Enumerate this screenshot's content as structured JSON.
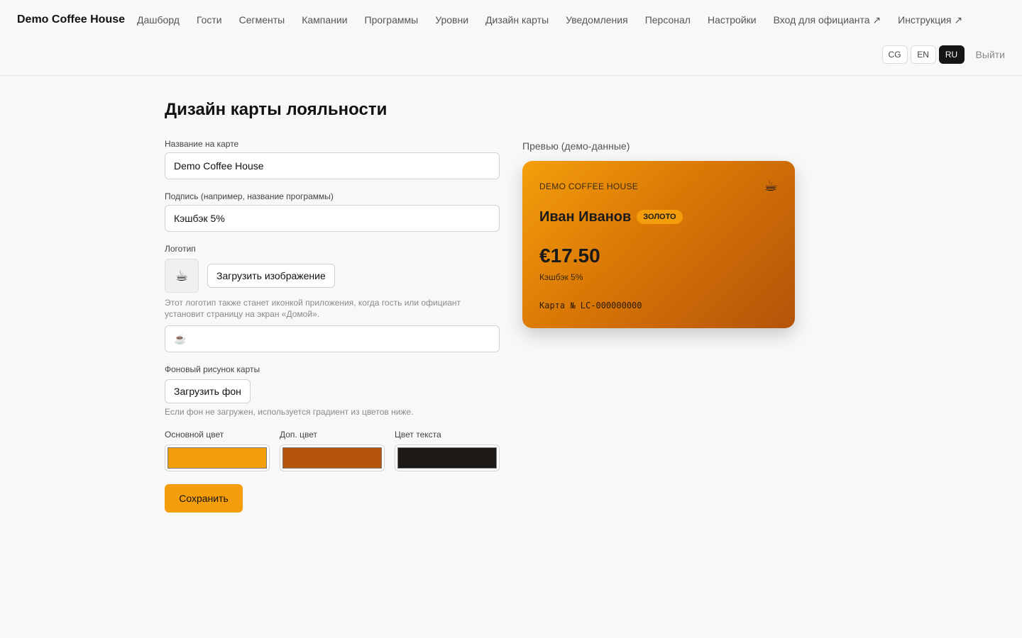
{
  "header": {
    "brand": "Demo Coffee House",
    "nav": [
      "Дашборд",
      "Гости",
      "Сегменты",
      "Кампании",
      "Программы",
      "Уровни",
      "Дизайн карты",
      "Уведомления",
      "Персонал",
      "Настройки",
      "Вход для официанта ↗",
      "Инструкция ↗"
    ],
    "languages": [
      "CG",
      "EN",
      "RU"
    ],
    "active_language": "RU",
    "logout": "Выйти"
  },
  "page": {
    "title": "Дизайн карты лояльности"
  },
  "form": {
    "card_name_label": "Название на карте",
    "card_name_value": "Demo Coffee House",
    "subtitle_label": "Подпись (например, название программы)",
    "subtitle_value": "Кэшбэк 5%",
    "logo_label": "Логотип",
    "logo_glyph": "☕",
    "upload_image": "Загрузить изображение",
    "logo_hint": "Этот логотип также станет иконкой приложения, когда гость или официант установит страницу на экран «Домой».",
    "logo_emoji_value": "☕",
    "background_label": "Фоновый рисунок карты",
    "upload_background": "Загрузить фон",
    "background_hint": "Если фон не загружен, используется градиент из цветов ниже.",
    "primary_color_label": "Основной цвет",
    "secondary_color_label": "Доп. цвет",
    "text_color_label": "Цвет текста",
    "primary_color": "#f59e0b",
    "secondary_color": "#b45309",
    "text_color": "#1c1917",
    "save": "Сохранить"
  },
  "preview": {
    "label": "Превью (демо-данные)",
    "org": "DEMO COFFEE HOUSE",
    "icon": "☕",
    "guest_name": "Иван Иванов",
    "tier": "ЗОЛОТО",
    "balance": "€17.50",
    "program": "Кэшбэк 5%",
    "card_number": "Карта № LC-000000000"
  }
}
